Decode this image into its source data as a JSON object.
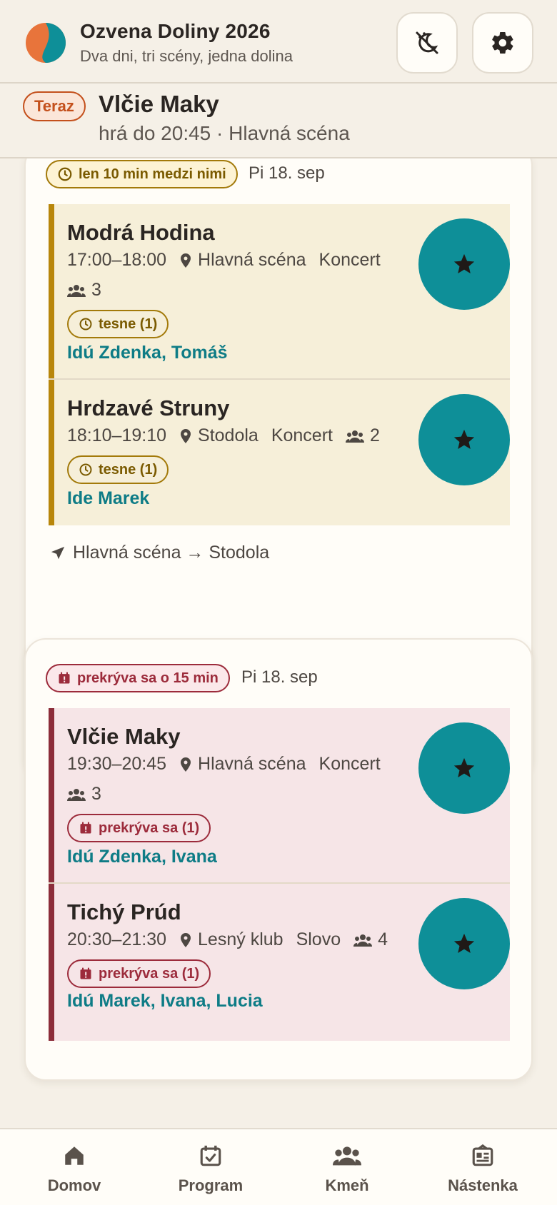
{
  "header": {
    "title": "Ozvena Doliny 2026",
    "subtitle": "Dva dni, tri scény, jedna dolina",
    "logo_icon": "split-circle-logo",
    "theme_button_icon": "theme-toggle-icon",
    "settings_button_icon": "gear-icon"
  },
  "now_playing": {
    "badge": "Teraz",
    "title": "Vlčie Maky",
    "subtitle": "hrá do 20:45 · Hlavná scéna"
  },
  "groups": [
    {
      "pill_label": "len 10 min medzi nimi",
      "date": "Pi 18. sep",
      "events": [
        {
          "name": "Modrá Hodina",
          "time": "17:00–18:00",
          "stage": "Hlavná scéna",
          "type": "Koncert",
          "people": "3",
          "tag": "tesne (1)",
          "going": "Idú Zdenka, Tomáš"
        },
        {
          "name": "Hrdzavé Struny",
          "time": "18:10–19:10",
          "stage": "Stodola",
          "type": "Koncert",
          "people": "2",
          "tag": "tesne (1)",
          "going": "Ide Marek"
        }
      ],
      "route": "Hlavná scéna → Stodola"
    },
    {
      "pill_label": "prekrýva sa o 15 min",
      "date": "Pi 18. sep",
      "events": [
        {
          "name": "Vlčie Maky",
          "time": "19:30–20:45",
          "stage": "Hlavná scéna",
          "type": "Koncert",
          "people": "3",
          "tag": "prekrýva sa (1)",
          "going": "Idú Zdenka, Ivana"
        },
        {
          "name": "Tichý Prúd",
          "time": "20:30–21:30",
          "stage": "Lesný klub",
          "type": "Slovo",
          "people": "4",
          "tag": "prekrýva sa (1)",
          "going": "Idú Marek, Ivana, Lucia"
        }
      ]
    }
  ],
  "nav": [
    {
      "label": "Domov",
      "icon": "home-icon"
    },
    {
      "label": "Program",
      "icon": "calendar-check-icon"
    },
    {
      "label": "Kmeň",
      "icon": "group-icon"
    },
    {
      "label": "Nástenka",
      "icon": "board-icon"
    }
  ],
  "colors": {
    "accent_teal": "#0e8f98",
    "warn": "#b8860b",
    "danger": "#8c2d3a",
    "now_badge": "#c4501c"
  }
}
